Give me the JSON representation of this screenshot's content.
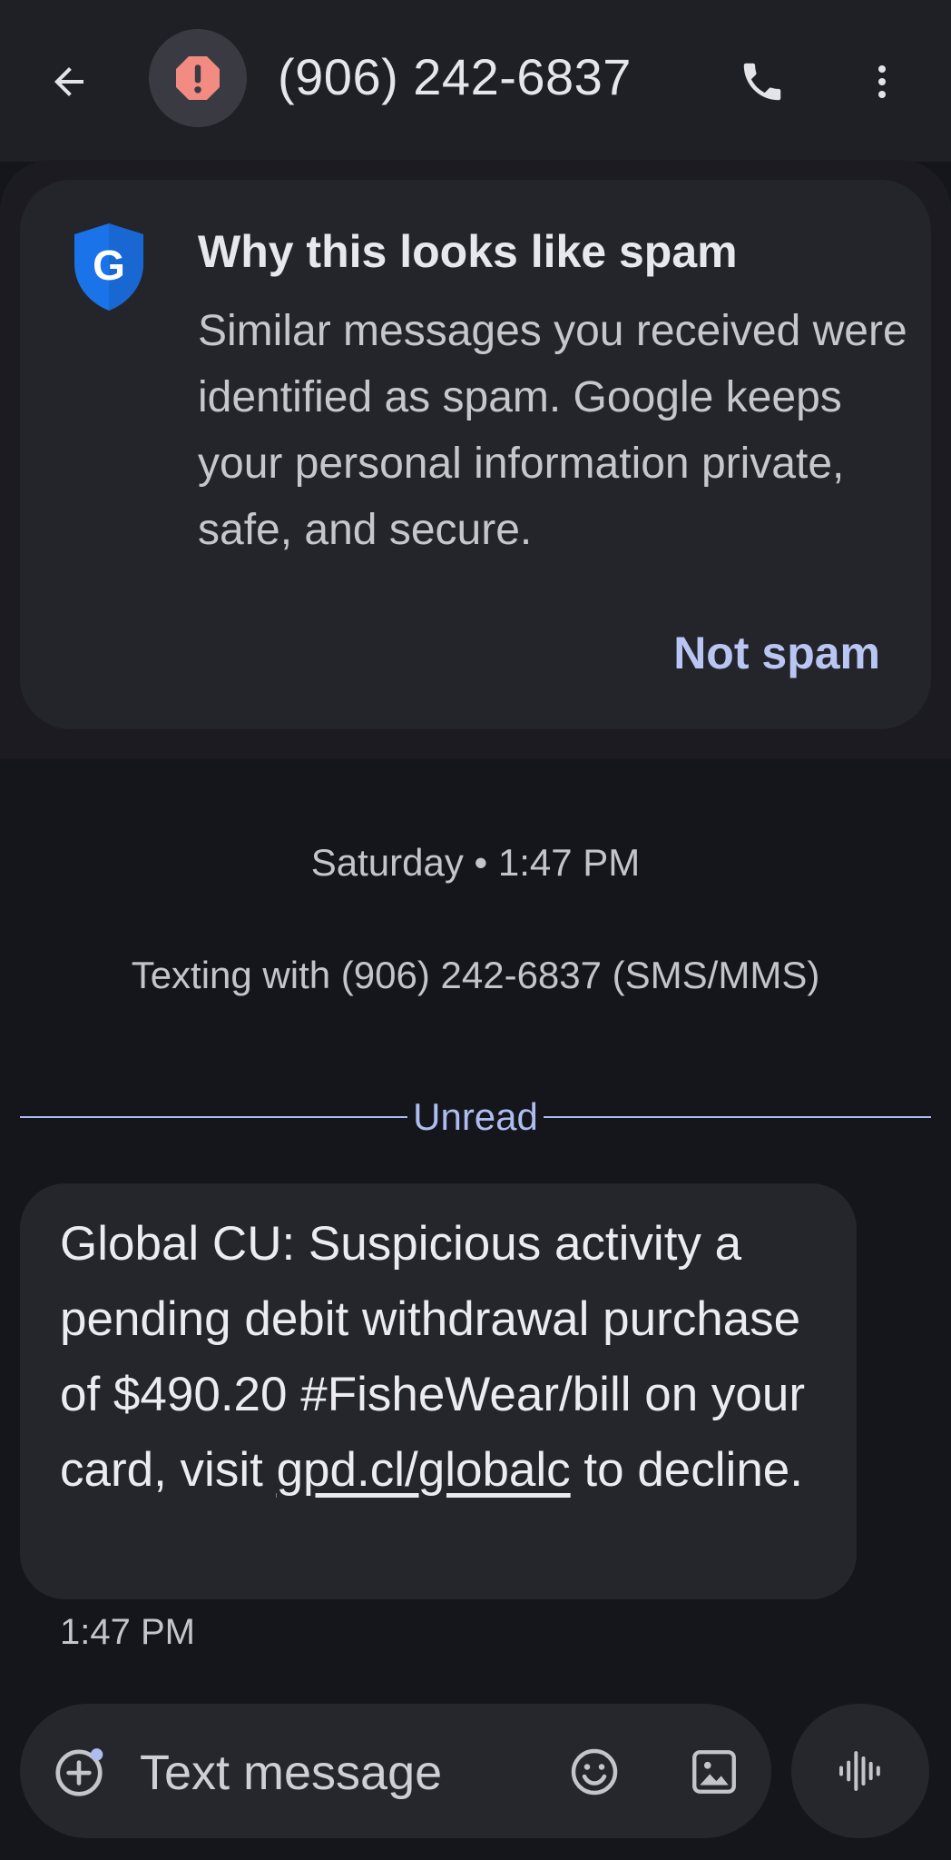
{
  "header": {
    "title": "(906) 242-6837",
    "icons": {
      "back": "arrow-back-icon",
      "avatar": "spam-warning-icon",
      "call": "phone-icon",
      "more": "more-vert-icon"
    }
  },
  "spam_card": {
    "icon": "google-shield-icon",
    "title": "Why this looks like spam",
    "body": "Similar messages you received were identified as spam. Google keeps your personal information private, safe, and secure.",
    "action_label": "Not spam"
  },
  "conversation": {
    "date_stamp": "Saturday • 1:47 PM",
    "texting_with": "Texting with (906) 242-6837 (SMS/MMS)",
    "unread_label": "Unread",
    "message": {
      "text_before_link": "Global CU: Suspicious activity a pending debit withdrawal purchase of $490.20 #FisheWear/bill on your card, visit ",
      "link": "gpd.cl/globalc",
      "text_after_link": " to decline.",
      "time": "1:47 PM"
    }
  },
  "composer": {
    "placeholder": "Text message",
    "icons": {
      "add": "add-attachment-icon",
      "emoji": "emoji-icon",
      "gallery": "gallery-icon",
      "voice": "voice-message-icon"
    }
  },
  "colors": {
    "background": "#15161b",
    "card": "#24252b",
    "accent": "#b9c6f3",
    "spam_badge": "#f28b82",
    "shield_blue": "#1a73e8"
  }
}
